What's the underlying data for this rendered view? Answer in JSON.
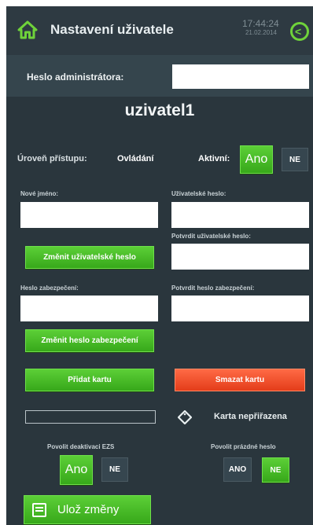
{
  "header": {
    "title": "Nastavení uživatele",
    "time": "17:44:24",
    "date": "21.02.2014",
    "icons": {
      "home": "home-icon",
      "back": "back-icon"
    },
    "accent": "#6fd23a"
  },
  "admin": {
    "label": "Heslo administrátora:",
    "value": ""
  },
  "user": {
    "name": "uzivatel1"
  },
  "access": {
    "level_label": "Úroveň přístupu:",
    "level_value": "Ovládání",
    "active_label": "Aktivní:",
    "yes": "Ano",
    "no": "NE"
  },
  "fields": {
    "new_name_label": "Nové jméno:",
    "new_name_value": "",
    "user_password_label": "Uživatelské heslo:",
    "user_password_value": "",
    "confirm_user_password_label": "Potvrdit uživatelské heslo:",
    "confirm_user_password_value": "",
    "security_password_label": "Heslo zabezpečení:",
    "security_password_value": "",
    "confirm_security_password_label": "Potvrdit heslo zabezpečení:",
    "confirm_security_password_value": ""
  },
  "buttons": {
    "change_user_password": "Změnit uživatelské heslo",
    "change_security_password": "Změnit heslo zabezpečení",
    "add_card": "Přidat kartu",
    "delete_card": "Smazat kartu"
  },
  "card": {
    "status": "Karta nepřiřazena",
    "icon": "tag-icon"
  },
  "ezs": {
    "label": "Povolit deaktivaci EZS",
    "yes": "Ano",
    "no": "NE"
  },
  "empty_password": {
    "label": "Povolit prázdné heslo",
    "yes": "ANO",
    "no": "NE"
  },
  "footer": {
    "save": "Ulož změny",
    "icon": "save-icon"
  },
  "colors": {
    "green": "#4dbf2a",
    "red": "#f25030",
    "background": "#2a363d"
  }
}
